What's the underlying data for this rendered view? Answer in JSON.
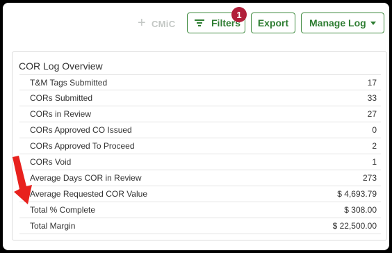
{
  "toolbar": {
    "cmic_label": "CMiC",
    "filters_label": "Filters",
    "filters_badge": "1",
    "export_label": "Export",
    "manage_log_label": "Manage Log"
  },
  "overview": {
    "title": "COR Log Overview",
    "rows": [
      {
        "label": "T&M Tags Submitted",
        "value": "17"
      },
      {
        "label": "CORs Submitted",
        "value": "33"
      },
      {
        "label": "CORs in Review",
        "value": "27"
      },
      {
        "label": "CORs Approved CO Issued",
        "value": "0"
      },
      {
        "label": "CORs Approved To Proceed",
        "value": "2"
      },
      {
        "label": "CORs Void",
        "value": "1"
      },
      {
        "label": "Average Days COR in Review",
        "value": "273"
      },
      {
        "label": "Average Requested COR Value",
        "value": "$ 4,693.79"
      },
      {
        "label": "Total % Complete",
        "value": "$ 308.00"
      },
      {
        "label": "Total Margin",
        "value": "$ 22,500.00"
      }
    ]
  },
  "colors": {
    "accent": "#2e7d32",
    "badge": "#b11f3a",
    "annotation_arrow": "#e8211d"
  },
  "icons": {
    "plus": "plus-icon",
    "filter": "filter-icon",
    "caret": "chevron-down-icon",
    "arrow": "annotation-arrow"
  }
}
